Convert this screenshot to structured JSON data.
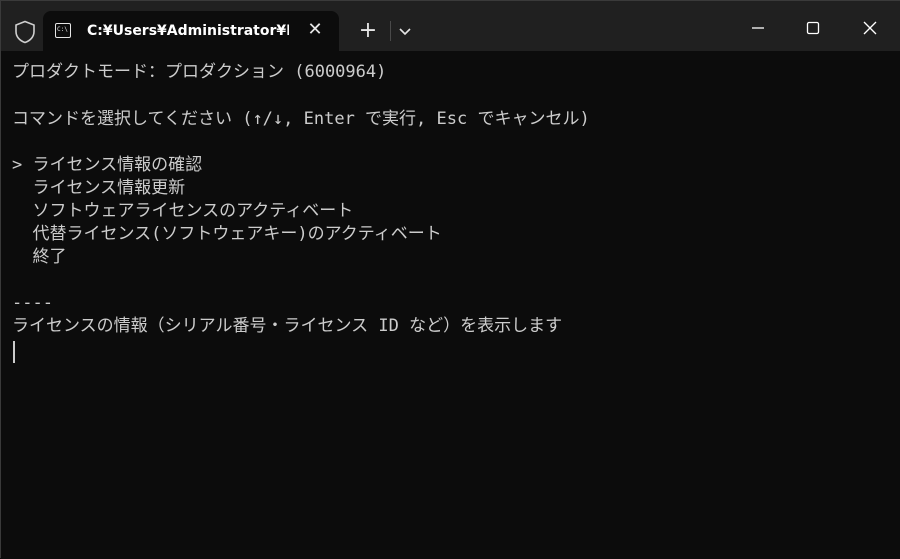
{
  "tab": {
    "title": "C:¥Users¥Administrator¥Deskt",
    "icon_text": "C:\\"
  },
  "terminal": {
    "header": "プロダクトモード：プロダクション (6000964)",
    "prompt": "コマンドを選択してください (↑/↓, Enter で実行, Esc でキャンセル)",
    "menu": [
      "> ライセンス情報の確認",
      "  ライセンス情報更新",
      "  ソフトウェアライセンスのアクティベート",
      "  代替ライセンス(ソフトウェアキー)のアクティベート",
      "  終了"
    ],
    "divider": "----",
    "description": "ライセンスの情報（シリアル番号・ライセンス ID など）を表示します"
  },
  "colors": {
    "titlebar": "#202020",
    "background": "#0c0c0c",
    "text": "#cccccc"
  }
}
